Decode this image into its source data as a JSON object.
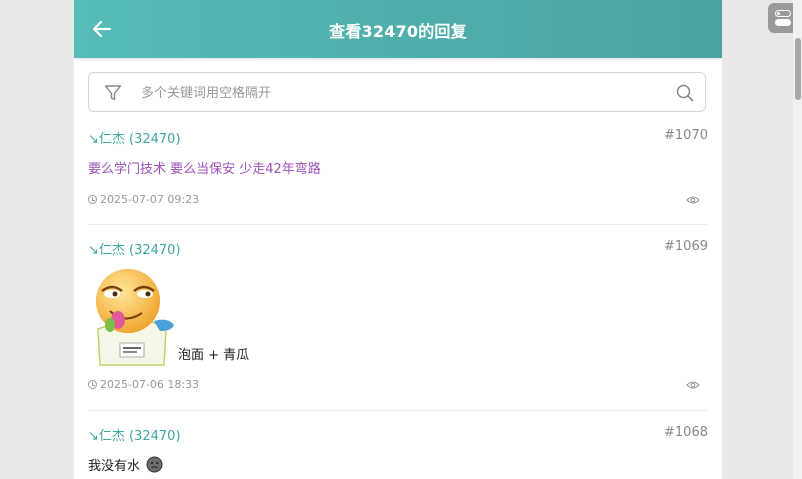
{
  "header": {
    "title": "查看32470的回复",
    "back_icon": "arrow-left-icon",
    "background": "#4fb0ab"
  },
  "search": {
    "placeholder": "多个关键词用空格隔开",
    "value": "",
    "filter_icon": "filter-icon",
    "search_icon": "search-icon"
  },
  "posts": [
    {
      "author": "↘仁杰 (32470)",
      "floor": "#1070",
      "content": "要么学门技术 要么当保安 少走42年弯路",
      "content_color": "#9b4fb8",
      "time": "2025-07-07 09:23"
    },
    {
      "author": "↘仁杰 (32470)",
      "floor": "#1069",
      "content": "泡面 + 青瓜",
      "content_color": "#222222",
      "time": "2025-07-06 18:33",
      "sticker_icon": "emoji-sticker-icon"
    },
    {
      "author": "↘仁杰 (32470)",
      "floor": "#1068",
      "content": "我没有水",
      "content_color": "#222222",
      "emoji_icon": "sad-face-icon"
    }
  ],
  "colors": {
    "accent": "#3da8a0",
    "page_bg": "#e8e8e8"
  }
}
